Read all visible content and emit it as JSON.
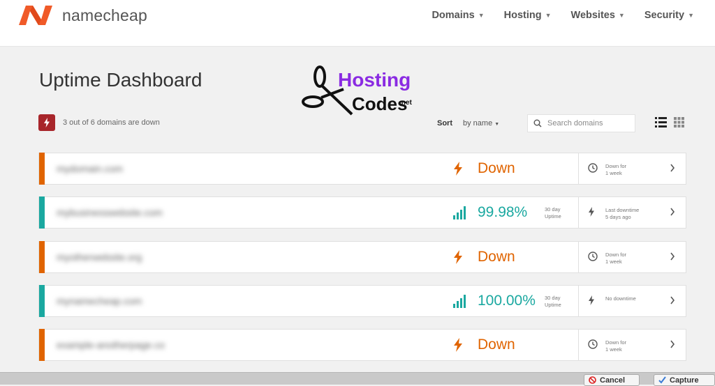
{
  "header": {
    "brand": "namecheap",
    "nav": [
      {
        "label": "Domains"
      },
      {
        "label": "Hosting"
      },
      {
        "label": "Websites"
      },
      {
        "label": "Security"
      }
    ]
  },
  "page": {
    "title": "Uptime Dashboard",
    "status_summary": "3 out of 6 domains are down"
  },
  "toolbar": {
    "sort_label": "Sort",
    "sort_value": "by name",
    "search_placeholder": "Search domains"
  },
  "watermark": {
    "line1": "Hosting",
    "line2": "Codes",
    "suffix": ".net"
  },
  "colors": {
    "down": "#e06400",
    "up": "#1aa8a0",
    "alert": "#a8262b"
  },
  "domains": [
    {
      "name": "mydomain.com",
      "status": "down",
      "stat": "Down",
      "uptime_label": "",
      "info_line1": "Down for",
      "info_line2": "1 week"
    },
    {
      "name": "mybusinesswebsite.com",
      "status": "up",
      "stat": "99.98%",
      "uptime_label": "30 day Uptime",
      "info_line1": "Last downtime",
      "info_line2": "5 days ago"
    },
    {
      "name": "myotherwebsite.org",
      "status": "down",
      "stat": "Down",
      "uptime_label": "",
      "info_line1": "Down for",
      "info_line2": "1 week"
    },
    {
      "name": "mynamecheap.com",
      "status": "up",
      "stat": "100.00%",
      "uptime_label": "30 day Uptime",
      "info_line1": "No downtime",
      "info_line2": ""
    },
    {
      "name": "example-anotherpage.co",
      "status": "down",
      "stat": "Down",
      "uptime_label": "",
      "info_line1": "Down for",
      "info_line2": "1 week"
    }
  ],
  "bottom": {
    "cancel": "Cancel",
    "capture": "Capture"
  }
}
